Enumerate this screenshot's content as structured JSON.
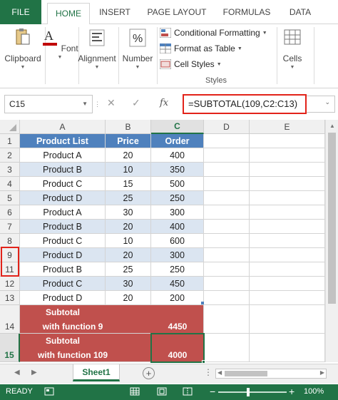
{
  "ribbon": {
    "tabs": [
      "FILE",
      "HOME",
      "INSERT",
      "PAGE LAYOUT",
      "FORMULAS",
      "DATA"
    ],
    "active_tab": "HOME",
    "groups": {
      "clipboard": "Clipboard",
      "font": "Font",
      "alignment": "Alignment",
      "number": "Number",
      "cells": "Cells"
    },
    "styles": {
      "conditional_formatting": "Conditional Formatting",
      "format_as_table": "Format as Table",
      "cell_styles": "Cell Styles",
      "label": "Styles"
    }
  },
  "formula_bar": {
    "name_box": "C15",
    "formula": "=SUBTOTAL(109,C2:C13)"
  },
  "sheet": {
    "column_headers": [
      "A",
      "B",
      "C",
      "D",
      "E"
    ],
    "header_row": {
      "row": "1",
      "product": "Product List",
      "price": "Price",
      "order": "Order"
    },
    "rows": [
      {
        "row": "2",
        "product": "Product A",
        "price": "20",
        "order": "400"
      },
      {
        "row": "3",
        "product": "Product B",
        "price": "10",
        "order": "350"
      },
      {
        "row": "4",
        "product": "Product C",
        "price": "15",
        "order": "500"
      },
      {
        "row": "5",
        "product": "Product D",
        "price": "25",
        "order": "250"
      },
      {
        "row": "6",
        "product": "Product A",
        "price": "30",
        "order": "300"
      },
      {
        "row": "7",
        "product": "Product B",
        "price": "20",
        "order": "400"
      },
      {
        "row": "8",
        "product": "Product C",
        "price": "10",
        "order": "600"
      },
      {
        "row": "9",
        "product": "Product D",
        "price": "20",
        "order": "300"
      },
      {
        "row": "11",
        "product": "Product B",
        "price": "25",
        "order": "250"
      },
      {
        "row": "12",
        "product": "Product C",
        "price": "30",
        "order": "450"
      },
      {
        "row": "13",
        "product": "Product D",
        "price": "20",
        "order": "200"
      }
    ],
    "subtotal_9": {
      "row": "14",
      "label_line1": "Subtotal",
      "label_line2": "with function 9",
      "value": "4450"
    },
    "subtotal_109": {
      "row": "15",
      "label_line1": "Subtotal",
      "label_line2": "with function 109",
      "value": "4000"
    }
  },
  "sheet_tabs": {
    "active": "Sheet1",
    "add": "+"
  },
  "status_bar": {
    "ready": "READY",
    "zoom": "100%"
  },
  "colors": {
    "excel_green": "#217346",
    "header_blue": "#4f81bd",
    "band_blue": "#dbe5f1",
    "subtotal_red": "#c0504d",
    "highlight_red": "#e2231a"
  }
}
